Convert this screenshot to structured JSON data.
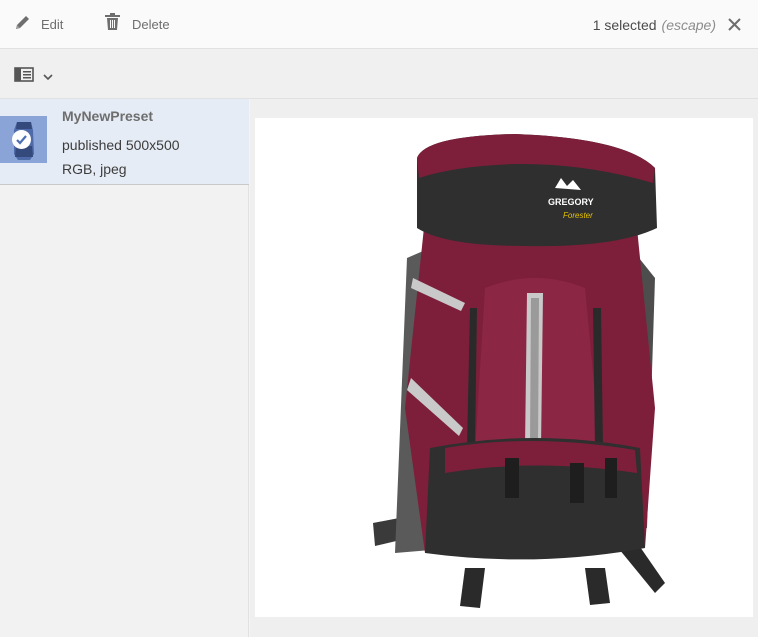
{
  "topbar": {
    "edit_label": "Edit",
    "delete_label": "Delete",
    "selected_count": "1 selected",
    "escape_hint": "(escape)"
  },
  "icons": {
    "edit": "pencil-icon",
    "delete": "trash-icon",
    "close": "close-icon",
    "view_switch": "column-view-icon",
    "dropdown": "chevron-down-icon",
    "selected": "checkmark-icon"
  },
  "list": {
    "items": [
      {
        "name": "MyNewPreset",
        "line1": "published 500x500",
        "line2": "RGB, jpeg",
        "selected": true
      }
    ]
  },
  "preview": {
    "logo_text": "GREGORY",
    "model_text": "Forester",
    "colors": {
      "body": "#7d1f3a",
      "dark": "#2f2f2f",
      "gray": "#5a5a5a",
      "strap": "#c9c9c9"
    }
  },
  "colors": {
    "selected_row": "#e6ecf5",
    "thumb": "#8aa4d8"
  }
}
